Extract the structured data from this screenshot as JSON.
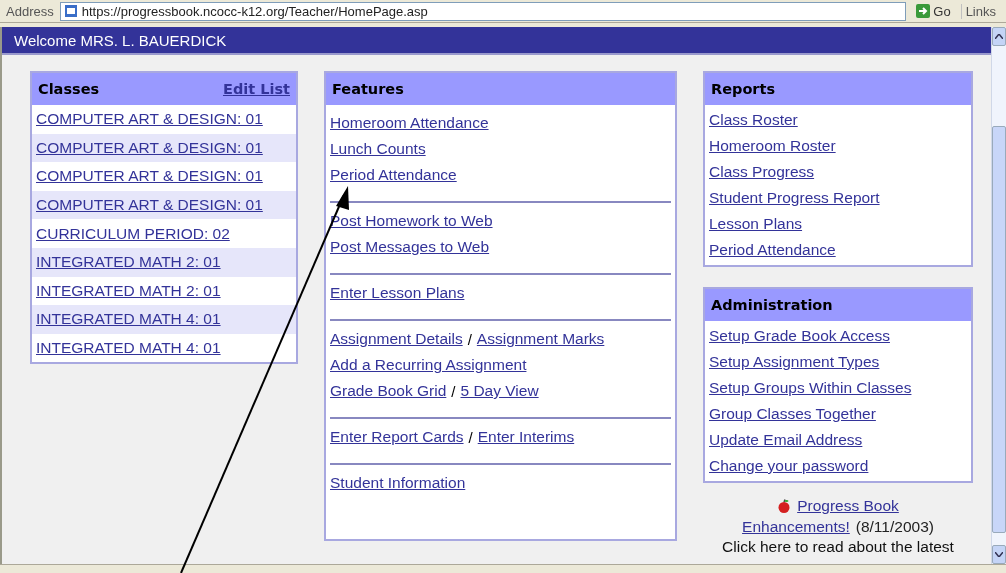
{
  "toolbar": {
    "address_label": "Address",
    "url": "https://progressbook.ncocc-k12.org/Teacher/HomePage.asp",
    "go": "Go",
    "links": "Links"
  },
  "welcome": "Welcome MRS. L. BAUERDICK",
  "classes": {
    "title": "Classes",
    "edit": "Edit List",
    "items": [
      {
        "label": "COMPUTER ART & DESIGN: 01"
      },
      {
        "label": "COMPUTER ART & DESIGN: 01"
      },
      {
        "label": "COMPUTER ART & DESIGN: 01"
      },
      {
        "label": "COMPUTER ART & DESIGN: 01"
      },
      {
        "label": "CURRICULUM PERIOD: 02"
      },
      {
        "label": "INTEGRATED MATH 2: 01"
      },
      {
        "label": "INTEGRATED MATH 2: 01"
      },
      {
        "label": "INTEGRATED MATH 4: 01"
      },
      {
        "label": "INTEGRATED MATH 4: 01"
      }
    ]
  },
  "features": {
    "title": "Features",
    "groups": [
      {
        "lines": [
          [
            {
              "kind": "link",
              "text": "Homeroom Attendance"
            }
          ],
          [
            {
              "kind": "link",
              "text": "Lunch Counts"
            }
          ],
          [
            {
              "kind": "link",
              "text": "Period Attendance"
            }
          ]
        ]
      },
      {
        "lines": [
          [
            {
              "kind": "link",
              "text": "Post Homework to Web"
            }
          ],
          [
            {
              "kind": "link",
              "text": "Post Messages to Web"
            }
          ]
        ]
      },
      {
        "lines": [
          [
            {
              "kind": "link",
              "text": "Enter Lesson Plans"
            }
          ]
        ]
      },
      {
        "lines": [
          [
            {
              "kind": "link",
              "text": "Assignment Details"
            },
            {
              "kind": "text",
              "text": "/"
            },
            {
              "kind": "link",
              "text": "Assignment Marks"
            }
          ],
          [
            {
              "kind": "link",
              "text": "Add a Recurring Assignment"
            }
          ],
          [
            {
              "kind": "link",
              "text": "Grade Book Grid"
            },
            {
              "kind": "text",
              "text": "/"
            },
            {
              "kind": "link",
              "text": "5 Day View"
            }
          ]
        ]
      },
      {
        "lines": [
          [
            {
              "kind": "link",
              "text": "Enter Report Cards"
            },
            {
              "kind": "text",
              "text": "/"
            },
            {
              "kind": "link",
              "text": "Enter Interims"
            }
          ]
        ]
      },
      {
        "lines": [
          [
            {
              "kind": "link",
              "text": "Student Information"
            }
          ]
        ]
      }
    ]
  },
  "reports": {
    "title": "Reports",
    "items": [
      "Class Roster",
      "Homeroom Roster",
      "Class Progress",
      "Student Progress Report",
      "Lesson Plans",
      "Period Attendance"
    ]
  },
  "administration": {
    "title": "Administration",
    "items": [
      "Setup Grade Book Access",
      "Setup Assignment Types",
      "Setup Groups Within Classes",
      "Group Classes Together",
      "Update Email Address",
      "Change your password"
    ]
  },
  "news": {
    "link_lines": [
      "Progress Book",
      "Enhancements!"
    ],
    "date": "(8/11/2003)",
    "text": "Click here to read about the latest"
  }
}
